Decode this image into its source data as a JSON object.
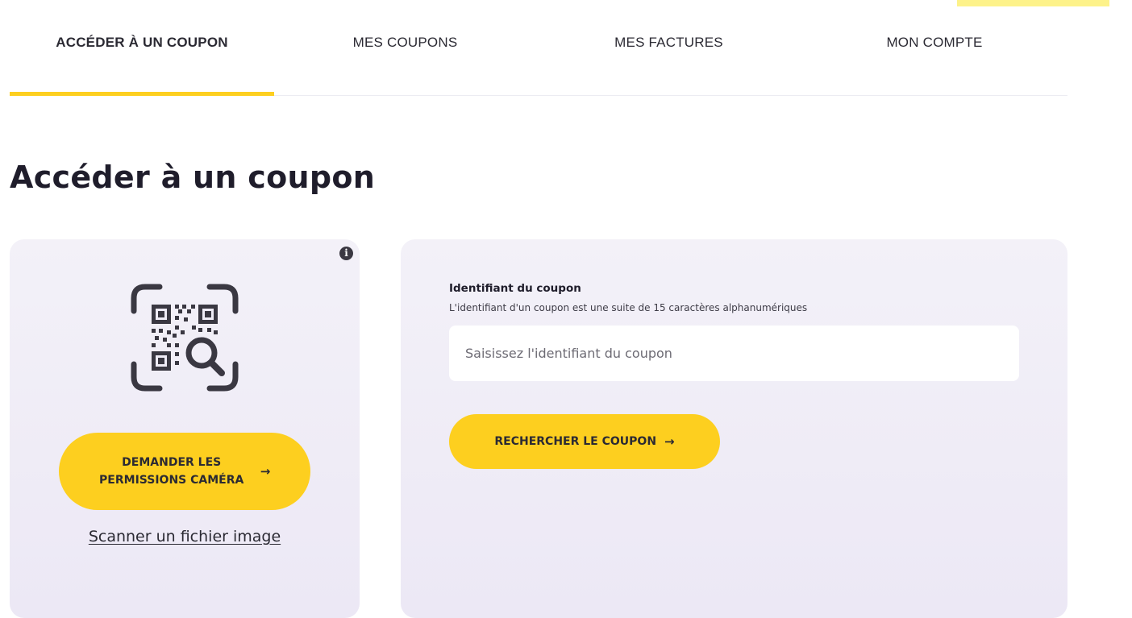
{
  "nav": {
    "tabs": [
      {
        "label": "ACCÉDER À UN COUPON",
        "active": true
      },
      {
        "label": "MES COUPONS",
        "active": false
      },
      {
        "label": "MES FACTURES",
        "active": false
      },
      {
        "label": "MON COMPTE",
        "active": false
      }
    ]
  },
  "page": {
    "title": "Accéder à un coupon"
  },
  "scanner": {
    "info_icon": "info-icon",
    "qr_icon": "qr-scan-icon",
    "camera_button_label": "DEMANDER LES PERMISSIONS CAMÉRA",
    "camera_button_arrow": "→",
    "scan_file_link": "Scanner un fichier image"
  },
  "search": {
    "label": "Identifiant du coupon",
    "help": "L'identifiant d'un coupon est une suite de 15 caractères alphanumériques",
    "input_value": "",
    "input_placeholder": "Saisissez l'identifiant du coupon",
    "button_label": "RECHERCHER LE COUPON",
    "button_arrow": "→"
  },
  "colors": {
    "accent": "#fdcf1f",
    "card_bg": "#efecf6",
    "text": "#1f1d2b"
  }
}
